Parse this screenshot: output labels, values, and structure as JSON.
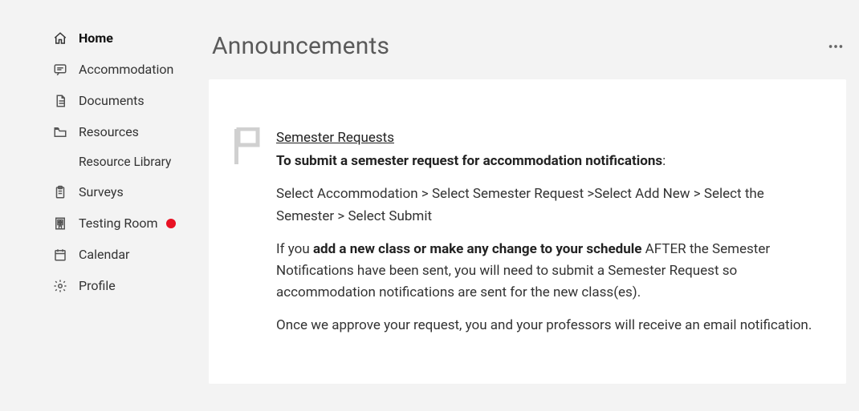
{
  "sidebar": {
    "items": [
      {
        "label": "Home",
        "icon": "home-icon",
        "active": true
      },
      {
        "label": "Accommodation",
        "icon": "chat-icon"
      },
      {
        "label": "Documents",
        "icon": "document-icon"
      },
      {
        "label": "Resources",
        "icon": "folder-icon",
        "sub": "Resource Library"
      },
      {
        "label": "Surveys",
        "icon": "clipboard-icon"
      },
      {
        "label": "Testing Room",
        "icon": "building-icon",
        "dot": true
      },
      {
        "label": "Calendar",
        "icon": "calendar-icon"
      },
      {
        "label": "Profile",
        "icon": "gear-icon"
      }
    ]
  },
  "main": {
    "title": "Announcements",
    "announcement": {
      "link_title": "Semester Requests",
      "subtitle_bold": "To submit a semester request for accommodation notifications",
      "subtitle_colon": ":",
      "steps": "Select Accommodation > Select Semester Request >Select Add New > Select the Semester > Select Submit",
      "cond_pre": "If you ",
      "cond_bold": "add a new class or make any change to your schedule",
      "cond_post": " AFTER the Semester Notifications have been sent, you will need to submit a Semester Request so accommodation notifications are sent for the new class(es).",
      "closing": "Once we approve your request, you and your professors will receive an email notification."
    }
  }
}
